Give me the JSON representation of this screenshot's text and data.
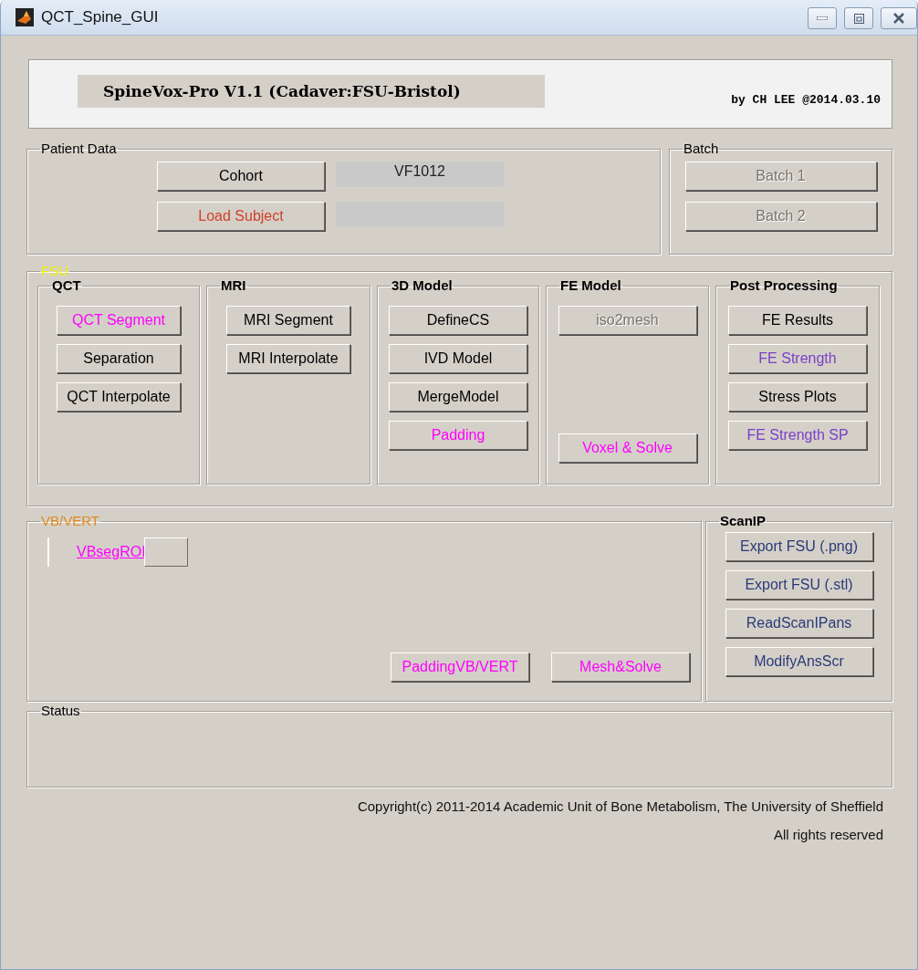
{
  "window": {
    "title": "QCT_Spine_GUI"
  },
  "header": {
    "title": "SpineVox-Pro V1.1 (Cadaver:FSU-Bristol)",
    "byline": "by CH LEE @2014.03.10"
  },
  "patient_data": {
    "legend": "Patient Data",
    "rows": [
      {
        "button": {
          "label": "Cohort",
          "color": "#000000",
          "disabled": false
        },
        "value": "VF1012"
      },
      {
        "button": {
          "label": "Load Subject",
          "color": "#d0402a",
          "disabled": false
        }
      }
    ]
  },
  "batch": {
    "legend": "Batch",
    "buttons": [
      {
        "label": "Batch 1",
        "disabled": true
      },
      {
        "label": "Batch 2",
        "disabled": true
      }
    ]
  },
  "fsu": {
    "legend": "FSU",
    "color": "#f0f000",
    "groups": [
      {
        "legend": "QCT",
        "buttons": [
          {
            "label": "QCT Segment",
            "color": "#ff00ff",
            "disabled": false
          },
          {
            "label": "Separation",
            "color": "#000000",
            "disabled": false
          },
          {
            "label": "QCT Interpolate",
            "color": "#000000",
            "disabled": false
          }
        ]
      },
      {
        "legend": "MRI",
        "buttons": [
          {
            "label": "MRI Segment",
            "color": "#000000",
            "disabled": false
          },
          {
            "label": "MRI Interpolate",
            "color": "#000000",
            "disabled": false
          }
        ]
      },
      {
        "legend": "3D Model",
        "buttons": [
          {
            "label": "DefineCS",
            "color": "#000000",
            "disabled": false
          },
          {
            "label": "IVD Model",
            "color": "#000000",
            "disabled": false
          },
          {
            "label": "MergeModel",
            "color": "#000000",
            "disabled": false
          },
          {
            "label": "Padding",
            "color": "#ff00ff",
            "disabled": false
          }
        ]
      },
      {
        "legend": "FE Model",
        "buttons": [
          {
            "label": "iso2mesh",
            "disabled": true
          },
          {
            "label": "Voxel & Solve",
            "color": "#ff00ff",
            "disabled": false
          }
        ]
      },
      {
        "legend": "Post Processing",
        "buttons": [
          {
            "label": "FE Results",
            "color": "#000000",
            "disabled": false
          },
          {
            "label": "FE Strength",
            "color": "#7b3fc8",
            "disabled": false
          },
          {
            "label": "Stress Plots",
            "color": "#000000",
            "disabled": false
          },
          {
            "label": "FE Strength SP",
            "color": "#7b3fc8",
            "disabled": false
          }
        ]
      }
    ]
  },
  "vb_vert": {
    "legend": "VB/VERT",
    "color": "#e08a20",
    "link": "VBsegROI",
    "buttons": [
      {
        "label": "PaddingVB/VERT",
        "color": "#ff00ff",
        "disabled": false
      },
      {
        "label": "Mesh&Solve",
        "color": "#ff00ff",
        "disabled": false
      }
    ]
  },
  "scanip": {
    "legend": "ScanIP",
    "buttons": [
      {
        "label": "Export FSU (.png)",
        "color": "#2a3a78",
        "disabled": false
      },
      {
        "label": "Export FSU (.stl)",
        "color": "#2a3a78",
        "disabled": false
      },
      {
        "label": "ReadScanIPans",
        "color": "#2a3a78",
        "disabled": false
      },
      {
        "label": "ModifyAnsScr",
        "color": "#2a3a78",
        "disabled": false
      }
    ]
  },
  "status": {
    "legend": "Status"
  },
  "footer": {
    "copyright": "Copyright(c) 2011-2014 Academic Unit of Bone Metabolism, The University of Sheffield",
    "rights": "All rights reserved"
  }
}
